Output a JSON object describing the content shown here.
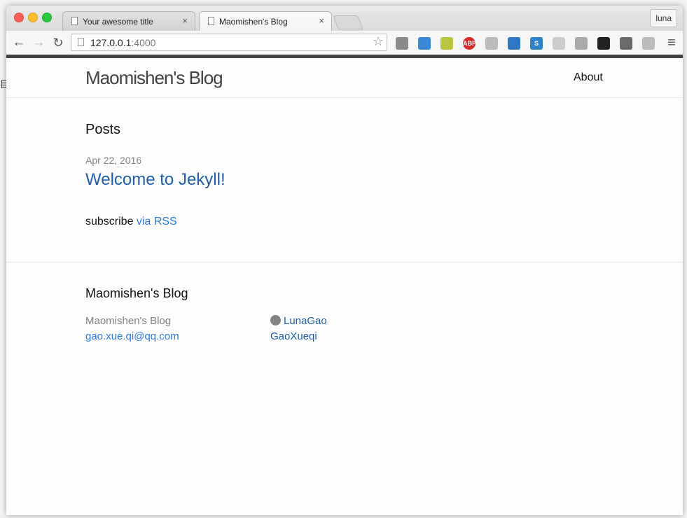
{
  "browser": {
    "tabs": [
      {
        "title": "Your awesome title",
        "close": "×"
      },
      {
        "title": "Maomishen's Blog",
        "close": "×"
      }
    ],
    "profile": "luna",
    "url_host": "127.0.0.1",
    "url_port": ":4000",
    "nav": {
      "back": "←",
      "forward": "→",
      "reload": "↻",
      "star": "☆",
      "menu": "≡"
    },
    "extensions": [
      {
        "name": "gear-extension-icon",
        "color": "#8a8a8a",
        "label": ""
      },
      {
        "name": "globe-extension-icon",
        "color": "#3a88d8",
        "label": ""
      },
      {
        "name": "evernote-extension-icon",
        "color": "#b8c640",
        "label": ""
      },
      {
        "name": "adblock-extension-icon",
        "color": "#d62b2b",
        "label": "ABP"
      },
      {
        "name": "translate-extension-icon",
        "color": "#bbbbbb",
        "label": ""
      },
      {
        "name": "download-extension-icon",
        "color": "#2f78c4",
        "label": ""
      },
      {
        "name": "s-extension-icon",
        "color": "#2e82c8",
        "label": "S"
      },
      {
        "name": "react-extension-icon",
        "color": "#cccccc",
        "label": ""
      },
      {
        "name": "tools-extension-icon",
        "color": "#aaaaaa",
        "label": ""
      },
      {
        "name": "tampermonkey-extension-icon",
        "color": "#222222",
        "label": ""
      },
      {
        "name": "puzzle-extension-icon",
        "color": "#6a6a6a",
        "label": ""
      },
      {
        "name": "network-extension-icon",
        "color": "#bbbbbb",
        "label": ""
      }
    ]
  },
  "site": {
    "title": "Maomishen's Blog",
    "nav_about": "About",
    "posts_heading": "Posts",
    "posts": [
      {
        "date": "Apr 22, 2016",
        "title": "Welcome to Jekyll!"
      }
    ],
    "subscribe_text": "subscribe ",
    "subscribe_link": "via RSS"
  },
  "footer": {
    "heading": "Maomishen's Blog",
    "name": "Maomishen's Blog",
    "email": "gao.xue.qi@qq.com",
    "github": "LunaGao",
    "twitter": "GaoXueqi"
  },
  "colors": {
    "link": "#2a7ae2",
    "accent_bar": "#424242",
    "meta": "#828282"
  }
}
